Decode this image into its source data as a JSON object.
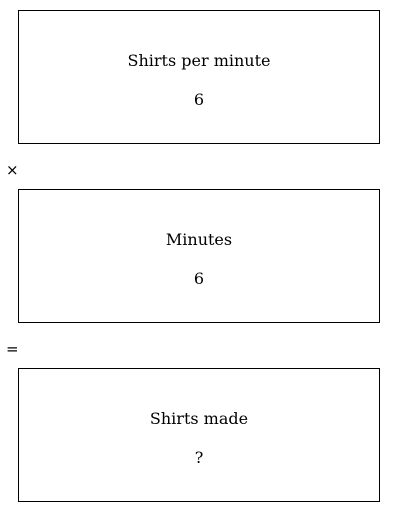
{
  "boxes": [
    {
      "label": "Shirts per minute",
      "value": "6"
    },
    {
      "label": "Minutes",
      "value": "6"
    },
    {
      "label": "Shirts made",
      "value": "?"
    }
  ],
  "operators": [
    "×",
    "="
  ]
}
